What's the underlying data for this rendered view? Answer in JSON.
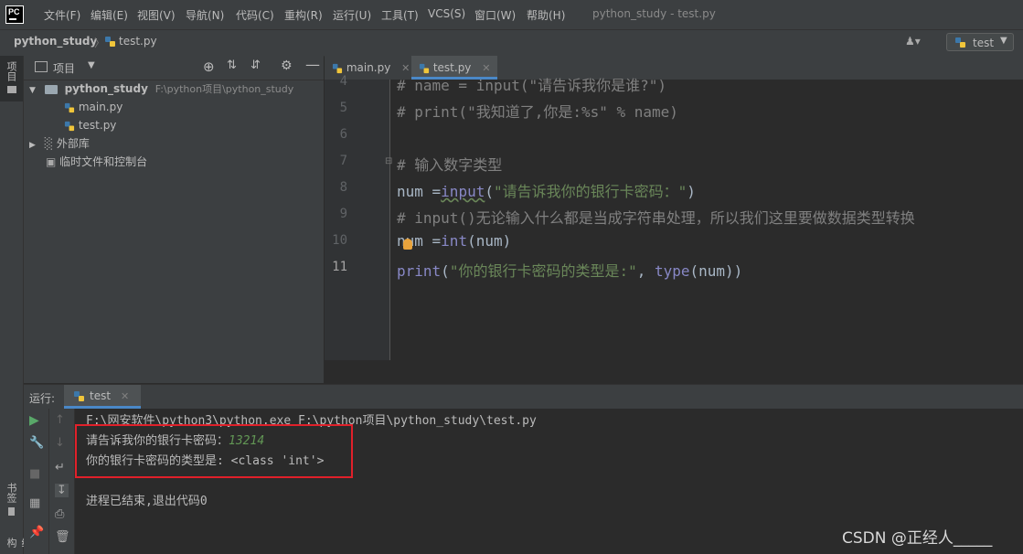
{
  "menubar": {
    "logo_text": "PC",
    "items": [
      "文件(F)",
      "编辑(E)",
      "视图(V)",
      "导航(N)",
      "代码(C)",
      "重构(R)",
      "运行(U)",
      "工具(T)",
      "VCS(S)",
      "窗口(W)",
      "帮助(H)"
    ],
    "window_title": "python_study - test.py"
  },
  "navbar": {
    "project": "python_study",
    "separator": "〉",
    "file": "test.py",
    "user_icon": "user-icon",
    "run_config": "test"
  },
  "left_strip": {
    "project_tab": "项目",
    "bookmarks_tab": "书签",
    "structure_tab": "结构"
  },
  "project_panel": {
    "title": "项目",
    "root": {
      "name": "python_study",
      "path": "F:\\python项目\\python_study"
    },
    "files": [
      "main.py",
      "test.py"
    ],
    "external_libs": "外部库",
    "scratches": "临时文件和控制台"
  },
  "editor": {
    "tabs": [
      {
        "label": "main.py",
        "active": false
      },
      {
        "label": "test.py",
        "active": true
      }
    ],
    "line_numbers": [
      "4",
      "5",
      "6",
      "7",
      "8",
      "9",
      "10",
      "11"
    ],
    "lines": {
      "l4": "# name = input(\"请告诉我你是谁?\")",
      "l5": "# print(\"我知道了,你是:%s\" % name)",
      "l6": "",
      "l7": "# 输入数字类型",
      "l8_a": "num =",
      "l8_fn": "input",
      "l8_paren": "(",
      "l8_str": "\"请告诉我你的银行卡密码：\"",
      "l8_end": ")",
      "l9": "# input()无论输入什么都是当成字符串处理，所以我们这里要做数据类型转换",
      "l10_a": "num =",
      "l10_fn": "int",
      "l10_end": "(num)",
      "l11_fn": "print",
      "l11_paren": "(",
      "l11_str": "\"你的银行卡密码的类型是:\"",
      "l11_comma": ", ",
      "l11_fn2": "type",
      "l11_end": "(num))"
    }
  },
  "run_panel": {
    "label": "运行:",
    "tab": "test",
    "output": {
      "command": "F:\\网安软件\\python3\\python.exe F:\\python项目\\python_study\\test.py",
      "prompt": "请告诉我你的银行卡密码：",
      "input_value": "13214",
      "result": "你的银行卡密码的类型是: <class 'int'>",
      "exit": "进程已结束,退出代码0"
    }
  },
  "watermark": "CSDN @正经人_____",
  "colors": {
    "accent": "#4a88c7",
    "highlight_box": "#e0202a",
    "string": "#6a8759",
    "comment": "#808080"
  }
}
